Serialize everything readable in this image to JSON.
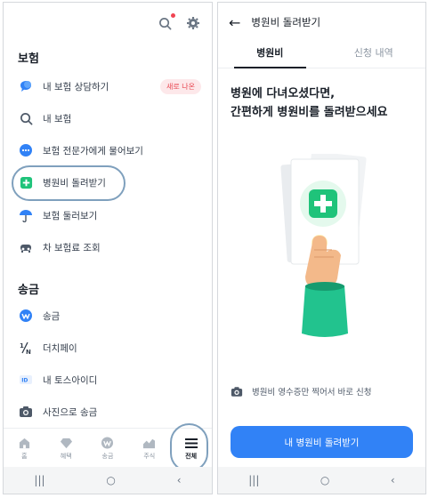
{
  "left": {
    "sections": [
      {
        "title": "보험",
        "items": [
          {
            "label": "내 보험 상담하기",
            "icon": "chat-bubble-icon",
            "badge": "새로 나온"
          },
          {
            "label": "내 보험",
            "icon": "search-icon"
          },
          {
            "label": "보험 전문가에게 물어보기",
            "icon": "speech-dots-icon"
          },
          {
            "label": "병원비 돌려받기",
            "icon": "plus-cross-icon"
          },
          {
            "label": "보험 둘러보기",
            "icon": "umbrella-icon"
          },
          {
            "label": "차 보험료 조회",
            "icon": "car-icon"
          }
        ]
      },
      {
        "title": "송금",
        "items": [
          {
            "label": "송금",
            "icon": "transfer-icon"
          },
          {
            "label": "더치페이",
            "icon": "split-fraction-icon"
          },
          {
            "label": "내 토스아이디",
            "icon": "id-icon"
          },
          {
            "label": "사진으로 송금",
            "icon": "camera-icon"
          }
        ]
      }
    ],
    "bottom_nav": [
      {
        "label": "홈",
        "icon": "home-icon"
      },
      {
        "label": "혜택",
        "icon": "diamond-icon"
      },
      {
        "label": "송금",
        "icon": "transfer-icon"
      },
      {
        "label": "주식",
        "icon": "chart-icon"
      },
      {
        "label": "전체",
        "icon": "menu-icon",
        "active": true
      }
    ],
    "system_nav": [
      "|||",
      "○",
      "‹"
    ]
  },
  "right": {
    "title": "병원비 돌려받기",
    "tabs": [
      {
        "label": "병원비",
        "active": true
      },
      {
        "label": "신청 내역",
        "active": false
      }
    ],
    "headline_line1": "병원에 다녀오셨다면,",
    "headline_line2": "간편하게 병원비를 돌려받으세요",
    "note": "병원비 영수증만 찍어서 바로 신청",
    "cta": "내 병원비 돌려받기",
    "system_nav": [
      "|||",
      "○",
      "‹"
    ]
  },
  "colors": {
    "primary": "#3182f6",
    "accent_green": "#1fc37a",
    "badge_red": "#e8434e",
    "highlight_oval": "#7fa0bd"
  }
}
